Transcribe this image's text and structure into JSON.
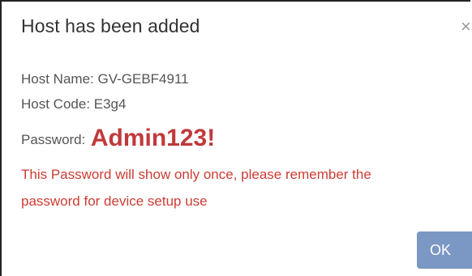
{
  "dialog": {
    "title": "Host has been added",
    "close_glyph": "×",
    "host_name_line": "Host Name: GV-GEBF4911",
    "host_code_line": "Host Code: E3g4",
    "password_label": "Password:",
    "password_value": "Admin123!",
    "warning_line1": "This Password will show only once, please remember the",
    "warning_line2": "password for device setup use",
    "ok_label": "OK"
  },
  "colors": {
    "password_value": "#c0393b",
    "warning_text": "#cc3d33",
    "ok_button_bg": "#7b97c4"
  }
}
